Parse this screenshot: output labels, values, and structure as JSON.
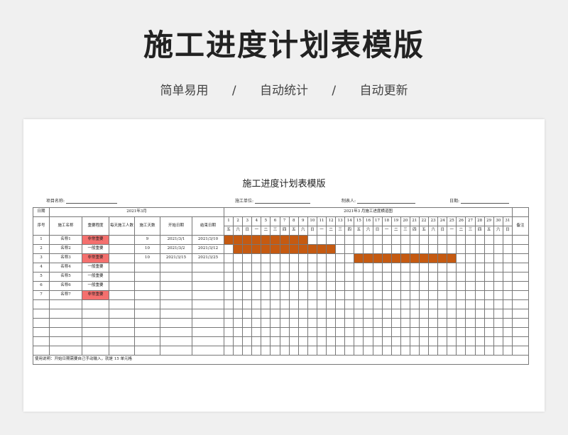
{
  "hero": {
    "title": "施工进度计划表模版",
    "tags": [
      "简单易用",
      "/",
      "自动统计",
      "/",
      "自动更新"
    ]
  },
  "doc": {
    "title": "施工进度计划表模版",
    "meta": {
      "project_label": "项目名称:",
      "unit_label": "施工单位:",
      "maker_label": "制表人:",
      "date_label": "日期:"
    },
    "table": {
      "date_label": "日期",
      "month_left": "2021年3月",
      "month_right": "2021年3  月施工进度横道图",
      "headers": {
        "seq": "序号",
        "name": "施工名称",
        "importance": "重要程度",
        "daily": "每天施工人数",
        "days": "施工天数",
        "start": "开始日期",
        "end": "结束日期",
        "remark": "备注"
      },
      "day_numbers": [
        "1",
        "2",
        "3",
        "4",
        "5",
        "6",
        "7",
        "8",
        "9",
        "10",
        "11",
        "12",
        "13",
        "14",
        "15",
        "16",
        "17",
        "18",
        "19",
        "20",
        "21",
        "22",
        "23",
        "24",
        "25",
        "26",
        "27",
        "28",
        "29",
        "30",
        "31"
      ],
      "weekdays": [
        "五",
        "六",
        "日",
        "一",
        "二",
        "三",
        "四",
        "五",
        "六",
        "日",
        "一",
        "二",
        "三",
        "四",
        "五",
        "六",
        "日",
        "一",
        "二",
        "三",
        "四",
        "五",
        "六",
        "日",
        "一",
        "二",
        "三",
        "四",
        "五",
        "六",
        "日"
      ],
      "rows": [
        {
          "seq": "1",
          "name": "名称1",
          "importance": "非常重要",
          "high": true,
          "daily": "",
          "days": "9",
          "start": "2021/3/1",
          "end": "2021/3/10",
          "bar_start_day": 1,
          "bar_end_day": 9
        },
        {
          "seq": "2",
          "name": "名称2",
          "importance": "一般重要",
          "high": false,
          "daily": "",
          "days": "10",
          "start": "2021/3/2",
          "end": "2021/3/12",
          "bar_start_day": 2,
          "bar_end_day": 12
        },
        {
          "seq": "3",
          "name": "名称3",
          "importance": "非常重要",
          "high": true,
          "daily": "",
          "days": "10",
          "start": "2021/3/15",
          "end": "2021/3/25",
          "bar_start_day": 15,
          "bar_end_day": 25
        },
        {
          "seq": "4",
          "name": "名称4",
          "importance": "一般重要",
          "high": false,
          "daily": "",
          "days": "",
          "start": "",
          "end": ""
        },
        {
          "seq": "5",
          "name": "名称5",
          "importance": "一般重要",
          "high": false,
          "daily": "",
          "days": "",
          "start": "",
          "end": ""
        },
        {
          "seq": "6",
          "name": "名称6",
          "importance": "一般重要",
          "high": false,
          "daily": "",
          "days": "",
          "start": "",
          "end": ""
        },
        {
          "seq": "7",
          "name": "名称7",
          "importance": "非常重要",
          "high": true,
          "daily": "",
          "days": "",
          "start": "",
          "end": ""
        }
      ],
      "empty_rows": 6,
      "note": "使用说明：开始日期需要自己手动输入，就是 15 单元格"
    },
    "colors": {
      "bar": "#c55a11",
      "high_importance": "#f4706e"
    }
  }
}
